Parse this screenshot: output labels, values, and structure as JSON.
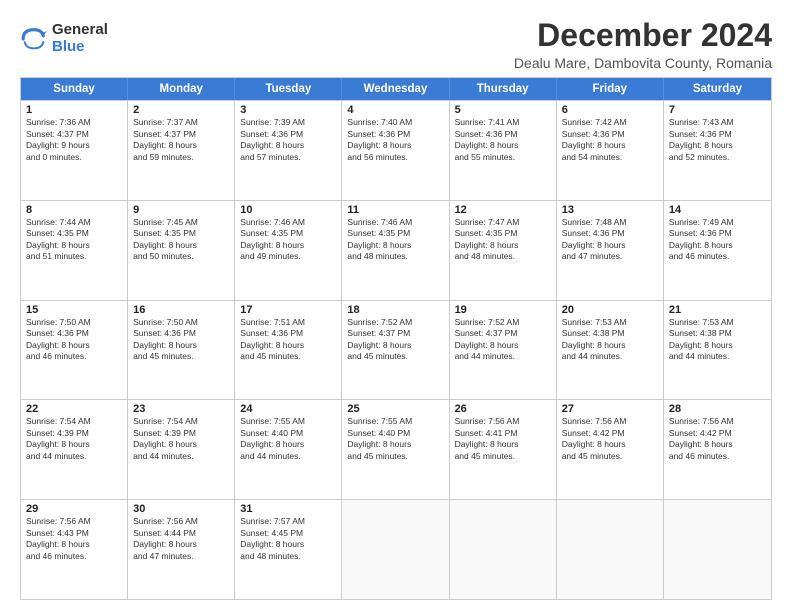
{
  "logo": {
    "general": "General",
    "blue": "Blue"
  },
  "header": {
    "month": "December 2024",
    "location": "Dealu Mare, Dambovita County, Romania"
  },
  "weekdays": [
    "Sunday",
    "Monday",
    "Tuesday",
    "Wednesday",
    "Thursday",
    "Friday",
    "Saturday"
  ],
  "weeks": [
    [
      {
        "day": "1",
        "lines": [
          "Sunrise: 7:36 AM",
          "Sunset: 4:37 PM",
          "Daylight: 9 hours",
          "and 0 minutes."
        ]
      },
      {
        "day": "2",
        "lines": [
          "Sunrise: 7:37 AM",
          "Sunset: 4:37 PM",
          "Daylight: 8 hours",
          "and 59 minutes."
        ]
      },
      {
        "day": "3",
        "lines": [
          "Sunrise: 7:39 AM",
          "Sunset: 4:36 PM",
          "Daylight: 8 hours",
          "and 57 minutes."
        ]
      },
      {
        "day": "4",
        "lines": [
          "Sunrise: 7:40 AM",
          "Sunset: 4:36 PM",
          "Daylight: 8 hours",
          "and 56 minutes."
        ]
      },
      {
        "day": "5",
        "lines": [
          "Sunrise: 7:41 AM",
          "Sunset: 4:36 PM",
          "Daylight: 8 hours",
          "and 55 minutes."
        ]
      },
      {
        "day": "6",
        "lines": [
          "Sunrise: 7:42 AM",
          "Sunset: 4:36 PM",
          "Daylight: 8 hours",
          "and 54 minutes."
        ]
      },
      {
        "day": "7",
        "lines": [
          "Sunrise: 7:43 AM",
          "Sunset: 4:36 PM",
          "Daylight: 8 hours",
          "and 52 minutes."
        ]
      }
    ],
    [
      {
        "day": "8",
        "lines": [
          "Sunrise: 7:44 AM",
          "Sunset: 4:35 PM",
          "Daylight: 8 hours",
          "and 51 minutes."
        ]
      },
      {
        "day": "9",
        "lines": [
          "Sunrise: 7:45 AM",
          "Sunset: 4:35 PM",
          "Daylight: 8 hours",
          "and 50 minutes."
        ]
      },
      {
        "day": "10",
        "lines": [
          "Sunrise: 7:46 AM",
          "Sunset: 4:35 PM",
          "Daylight: 8 hours",
          "and 49 minutes."
        ]
      },
      {
        "day": "11",
        "lines": [
          "Sunrise: 7:46 AM",
          "Sunset: 4:35 PM",
          "Daylight: 8 hours",
          "and 48 minutes."
        ]
      },
      {
        "day": "12",
        "lines": [
          "Sunrise: 7:47 AM",
          "Sunset: 4:35 PM",
          "Daylight: 8 hours",
          "and 48 minutes."
        ]
      },
      {
        "day": "13",
        "lines": [
          "Sunrise: 7:48 AM",
          "Sunset: 4:36 PM",
          "Daylight: 8 hours",
          "and 47 minutes."
        ]
      },
      {
        "day": "14",
        "lines": [
          "Sunrise: 7:49 AM",
          "Sunset: 4:36 PM",
          "Daylight: 8 hours",
          "and 46 minutes."
        ]
      }
    ],
    [
      {
        "day": "15",
        "lines": [
          "Sunrise: 7:50 AM",
          "Sunset: 4:36 PM",
          "Daylight: 8 hours",
          "and 46 minutes."
        ]
      },
      {
        "day": "16",
        "lines": [
          "Sunrise: 7:50 AM",
          "Sunset: 4:36 PM",
          "Daylight: 8 hours",
          "and 45 minutes."
        ]
      },
      {
        "day": "17",
        "lines": [
          "Sunrise: 7:51 AM",
          "Sunset: 4:36 PM",
          "Daylight: 8 hours",
          "and 45 minutes."
        ]
      },
      {
        "day": "18",
        "lines": [
          "Sunrise: 7:52 AM",
          "Sunset: 4:37 PM",
          "Daylight: 8 hours",
          "and 45 minutes."
        ]
      },
      {
        "day": "19",
        "lines": [
          "Sunrise: 7:52 AM",
          "Sunset: 4:37 PM",
          "Daylight: 8 hours",
          "and 44 minutes."
        ]
      },
      {
        "day": "20",
        "lines": [
          "Sunrise: 7:53 AM",
          "Sunset: 4:38 PM",
          "Daylight: 8 hours",
          "and 44 minutes."
        ]
      },
      {
        "day": "21",
        "lines": [
          "Sunrise: 7:53 AM",
          "Sunset: 4:38 PM",
          "Daylight: 8 hours",
          "and 44 minutes."
        ]
      }
    ],
    [
      {
        "day": "22",
        "lines": [
          "Sunrise: 7:54 AM",
          "Sunset: 4:39 PM",
          "Daylight: 8 hours",
          "and 44 minutes."
        ]
      },
      {
        "day": "23",
        "lines": [
          "Sunrise: 7:54 AM",
          "Sunset: 4:39 PM",
          "Daylight: 8 hours",
          "and 44 minutes."
        ]
      },
      {
        "day": "24",
        "lines": [
          "Sunrise: 7:55 AM",
          "Sunset: 4:40 PM",
          "Daylight: 8 hours",
          "and 44 minutes."
        ]
      },
      {
        "day": "25",
        "lines": [
          "Sunrise: 7:55 AM",
          "Sunset: 4:40 PM",
          "Daylight: 8 hours",
          "and 45 minutes."
        ]
      },
      {
        "day": "26",
        "lines": [
          "Sunrise: 7:56 AM",
          "Sunset: 4:41 PM",
          "Daylight: 8 hours",
          "and 45 minutes."
        ]
      },
      {
        "day": "27",
        "lines": [
          "Sunrise: 7:56 AM",
          "Sunset: 4:42 PM",
          "Daylight: 8 hours",
          "and 45 minutes."
        ]
      },
      {
        "day": "28",
        "lines": [
          "Sunrise: 7:56 AM",
          "Sunset: 4:42 PM",
          "Daylight: 8 hours",
          "and 46 minutes."
        ]
      }
    ],
    [
      {
        "day": "29",
        "lines": [
          "Sunrise: 7:56 AM",
          "Sunset: 4:43 PM",
          "Daylight: 8 hours",
          "and 46 minutes."
        ]
      },
      {
        "day": "30",
        "lines": [
          "Sunrise: 7:56 AM",
          "Sunset: 4:44 PM",
          "Daylight: 8 hours",
          "and 47 minutes."
        ]
      },
      {
        "day": "31",
        "lines": [
          "Sunrise: 7:57 AM",
          "Sunset: 4:45 PM",
          "Daylight: 8 hours",
          "and 48 minutes."
        ]
      },
      {
        "day": "",
        "lines": []
      },
      {
        "day": "",
        "lines": []
      },
      {
        "day": "",
        "lines": []
      },
      {
        "day": "",
        "lines": []
      }
    ]
  ]
}
